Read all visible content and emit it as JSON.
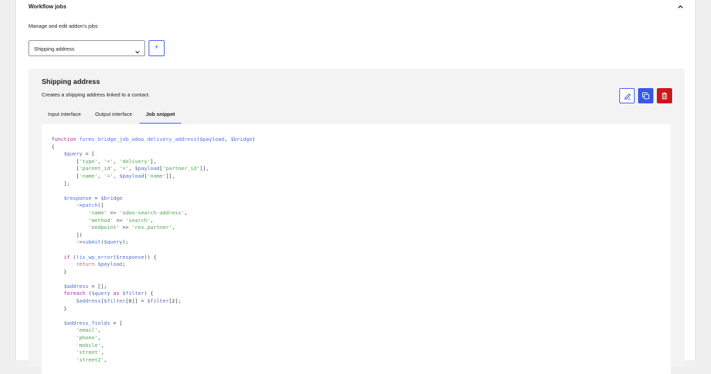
{
  "section": {
    "title": "Workflow jobs",
    "description": "Manage and edit addon's jobs"
  },
  "job_select": {
    "value": "Shipping address"
  },
  "add_button": {
    "label": "+"
  },
  "job": {
    "title": "Shipping address",
    "description": "Creates a shipping address linked to a contact."
  },
  "tabs": [
    {
      "label": "Input interface"
    },
    {
      "label": "Output interface"
    },
    {
      "label": "Job snippet"
    }
  ],
  "active_tab": "Job snippet",
  "actions": {
    "edit_icon": "edit-icon",
    "copy_icon": "copy-icon",
    "delete_icon": "trash-icon"
  },
  "colors": {
    "accent": "#3858e9",
    "danger": "#cc1818",
    "card_bg": "#f3f3f3"
  },
  "code_lines": [
    "function forms_bridge_job_odoo_delivery_address($payload, $bridge)",
    "{",
    "    $query = [",
    "        ['type', '=', 'delivery'],",
    "        ['parent_id', '=', $payload['partner_id']],",
    "        ['name', '=', $payload['name']],",
    "    ];",
    "",
    "    $response = $bridge",
    "        ->patch([",
    "            'name' => 'odoo-search-address',",
    "            'method' => 'search',",
    "            'endpoint' => 'res.partner',",
    "        ])",
    "        ->submit($query);",
    "",
    "    if (!is_wp_error($response)) {",
    "        return $payload;",
    "    }",
    "",
    "    $address = [];",
    "    foreach ($query as $filter) {",
    "        $address[$filter[0]] = $filter[2];",
    "    }",
    "",
    "    $address_fields = [",
    "        'email',",
    "        'phone',",
    "        'mobile',",
    "        'street',",
    "        'street2',"
  ]
}
